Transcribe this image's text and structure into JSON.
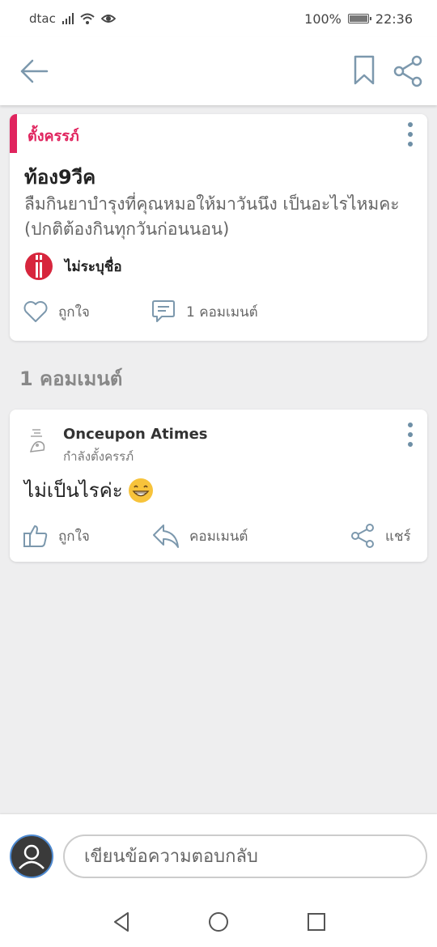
{
  "status": {
    "carrier": "dtac",
    "battery": "100%",
    "time": "22:36"
  },
  "post": {
    "tag": "ตั้งครรภ์",
    "title": "ท้อง9วีค",
    "body": "ลืมกินยาบำรุงที่คุณหมอให้มาวันนึง เป็นอะไรไหมคะ (ปกติต้องกินทุกวันก่อนนอน)",
    "author": "ไม่ระบุชื่อ",
    "like_label": "ถูกใจ",
    "comment_label": "1 คอมเมนต์"
  },
  "comments_heading": "1 คอมเมนต์",
  "comment": {
    "user": "Onceupon Atimes",
    "subtitle": "กำลังตั้งครรภ์",
    "text": "ไม่เป็นไรค่ะ",
    "emoji": "grinning-face-icon",
    "like_label": "ถูกใจ",
    "reply_label": "คอมเมนต์",
    "share_label": "แชร์"
  },
  "reply_box": {
    "placeholder": "เขียนข้อความตอบกลับ"
  },
  "colors": {
    "accent": "#e0245e",
    "kebab": "#6e8fa6",
    "icon": "#7c98ad"
  }
}
